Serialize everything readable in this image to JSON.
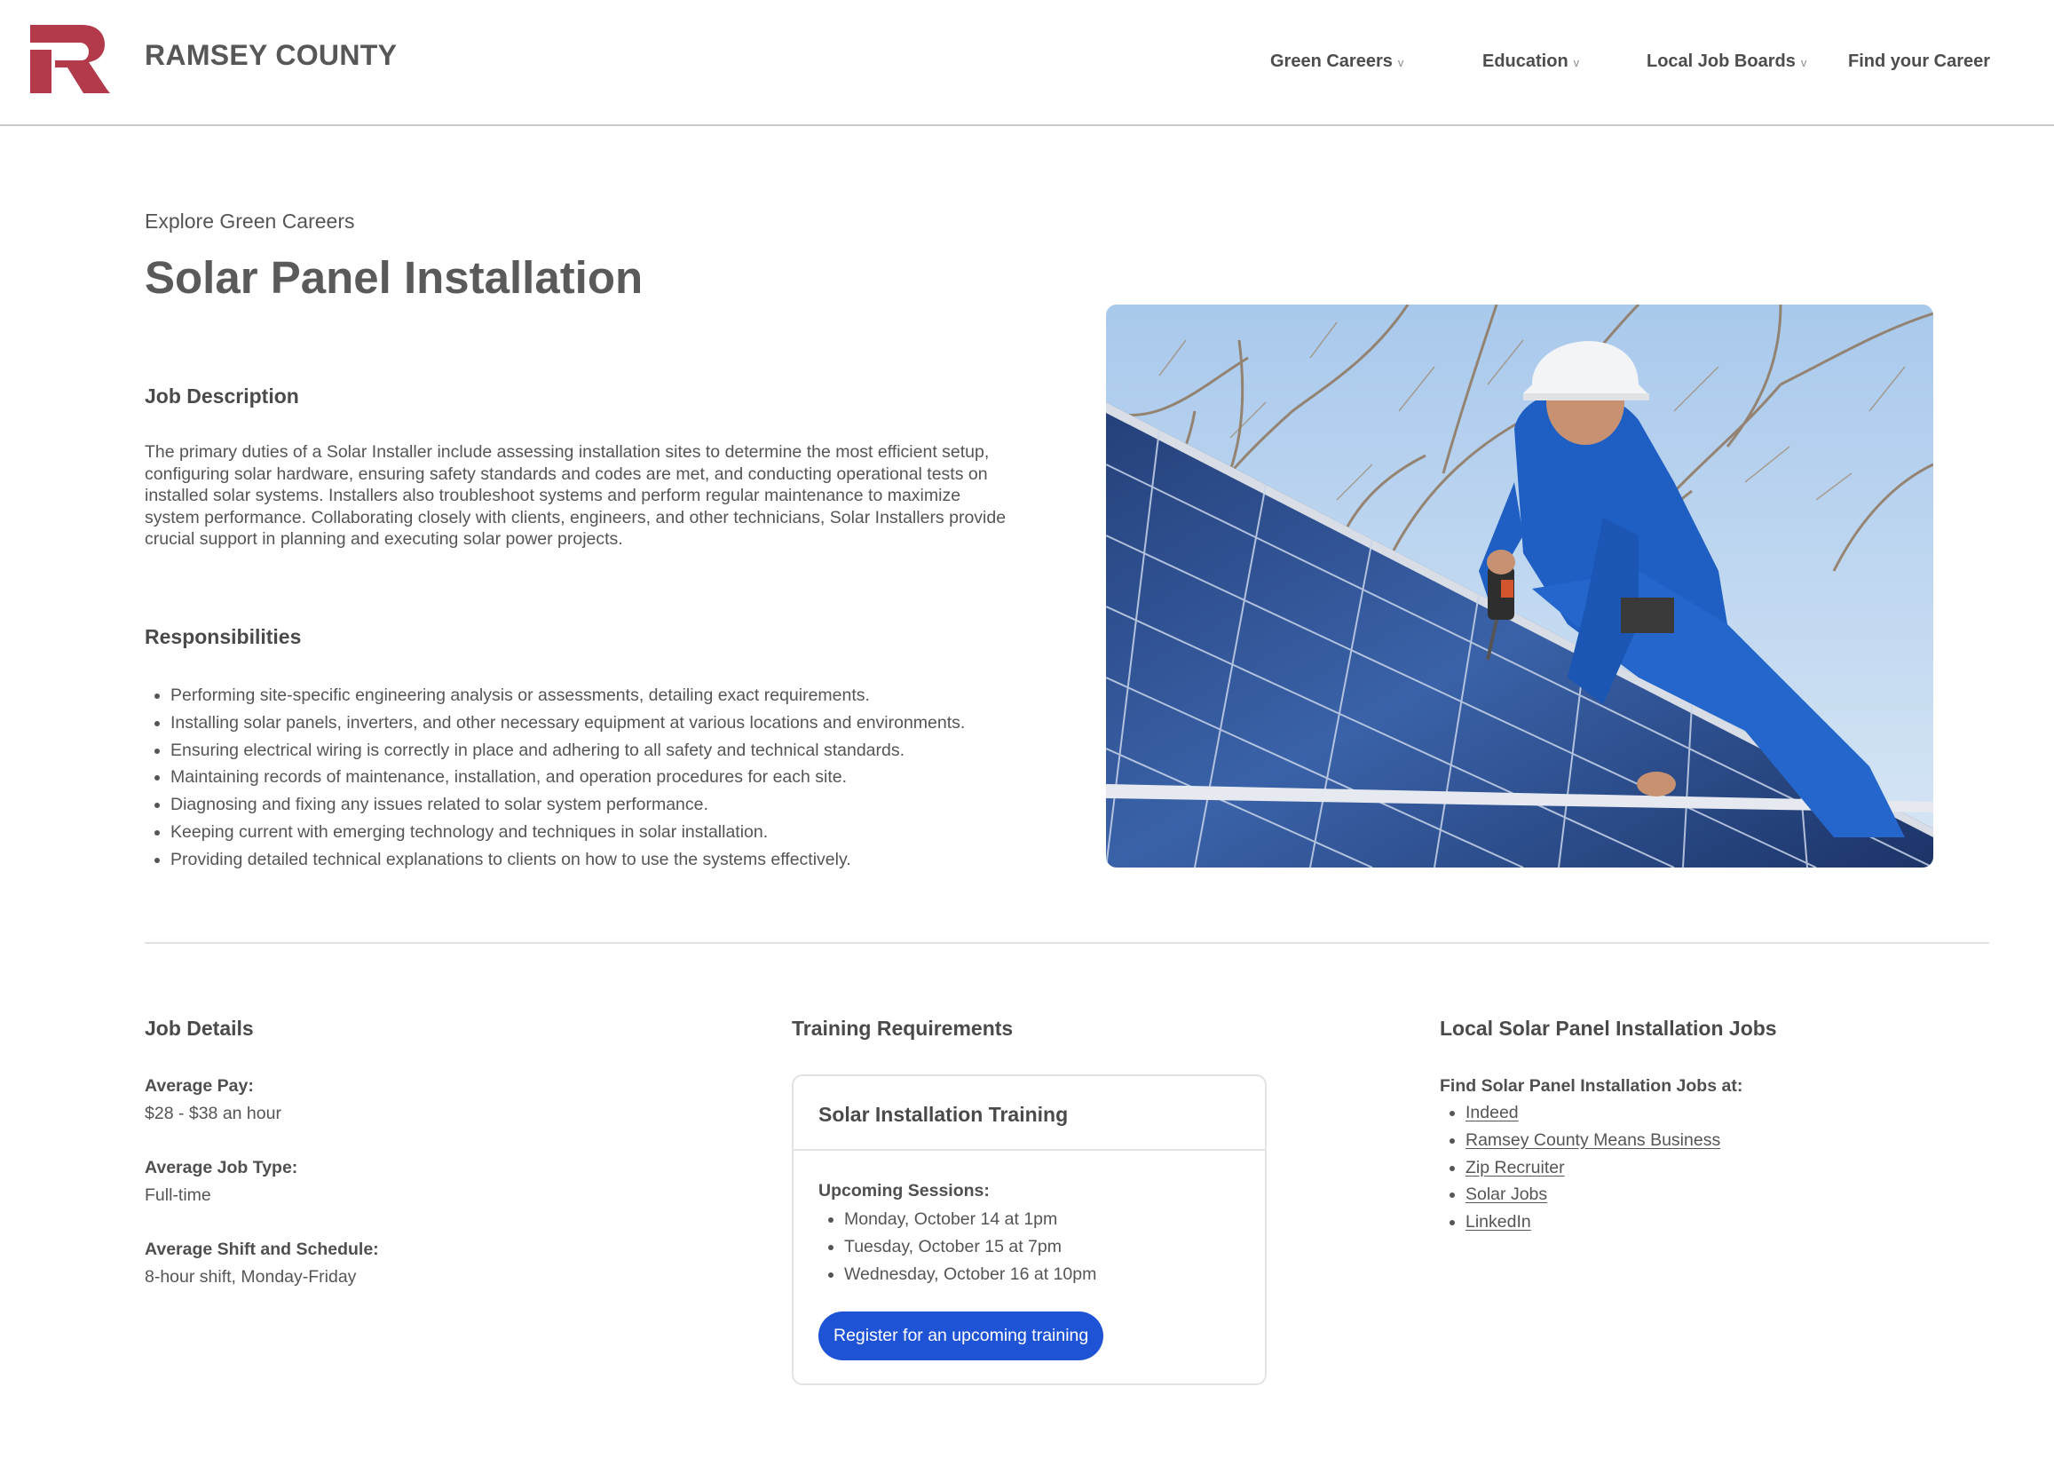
{
  "header": {
    "brand": "RAMSEY COUNTY",
    "nav": [
      {
        "label": "Green Careers",
        "chevron": "v"
      },
      {
        "label": "Education",
        "chevron": "v"
      },
      {
        "label": "Local Job Boards",
        "chevron": "v"
      },
      {
        "label": "Find your Career"
      }
    ]
  },
  "hero": {
    "kicker": "Explore Green Careers",
    "title": "Solar Panel Installation",
    "description_heading": "Job Description",
    "description": "The primary duties of a Solar Installer include assessing installation sites to determine the most efficient setup, configuring solar hardware, ensuring safety standards and codes are met, and conducting operational tests on installed solar systems. Installers also troubleshoot systems and perform regular maintenance to maximize system performance. Collaborating closely with clients, engineers, and other technicians, Solar Installers provide crucial support in planning and executing solar power projects.",
    "responsibilities_heading": "Responsibilities",
    "responsibilities": [
      "Performing site-specific engineering analysis or assessments, detailing exact requirements.",
      "Installing solar panels, inverters, and other necessary equipment at various locations and environments.",
      "Ensuring electrical wiring is correctly in place and adhering to all safety and technical standards.",
      "Maintaining records of maintenance, installation, and operation procedures for each site.",
      "Diagnosing and fixing any issues related to solar system performance.",
      "Keeping current with emerging technology and techniques in solar installation.",
      "Providing detailed technical explanations to clients on how to use the systems effectively."
    ]
  },
  "job_details": {
    "heading": "Job Details",
    "pay_label": "Average Pay:",
    "pay_value": "$28 - $38 an hour",
    "type_label": "Average Job Type:",
    "type_value": "Full-time",
    "schedule_label": "Average Shift and Schedule:",
    "schedule_value": "8-hour shift, Monday-Friday"
  },
  "training": {
    "heading": "Training Requirements",
    "card_title": "Solar Installation Training",
    "sessions_label": "Upcoming Sessions:",
    "sessions": [
      "Monday, October 14 at 1pm",
      "Tuesday, October 15 at 7pm",
      "Wednesday, October 16 at 10pm"
    ],
    "register_label": "Register for an upcoming training"
  },
  "local_jobs": {
    "heading": "Local Solar Panel Installation Jobs",
    "find_label": "Find Solar Panel Installation Jobs at:",
    "links": [
      "Indeed",
      "Ramsey County Means Business",
      "Zip Recruiter",
      "Solar Jobs",
      "LinkedIn"
    ]
  },
  "colors": {
    "logo": "#b23a4a",
    "button": "#1f53d6",
    "text": "#555555"
  }
}
